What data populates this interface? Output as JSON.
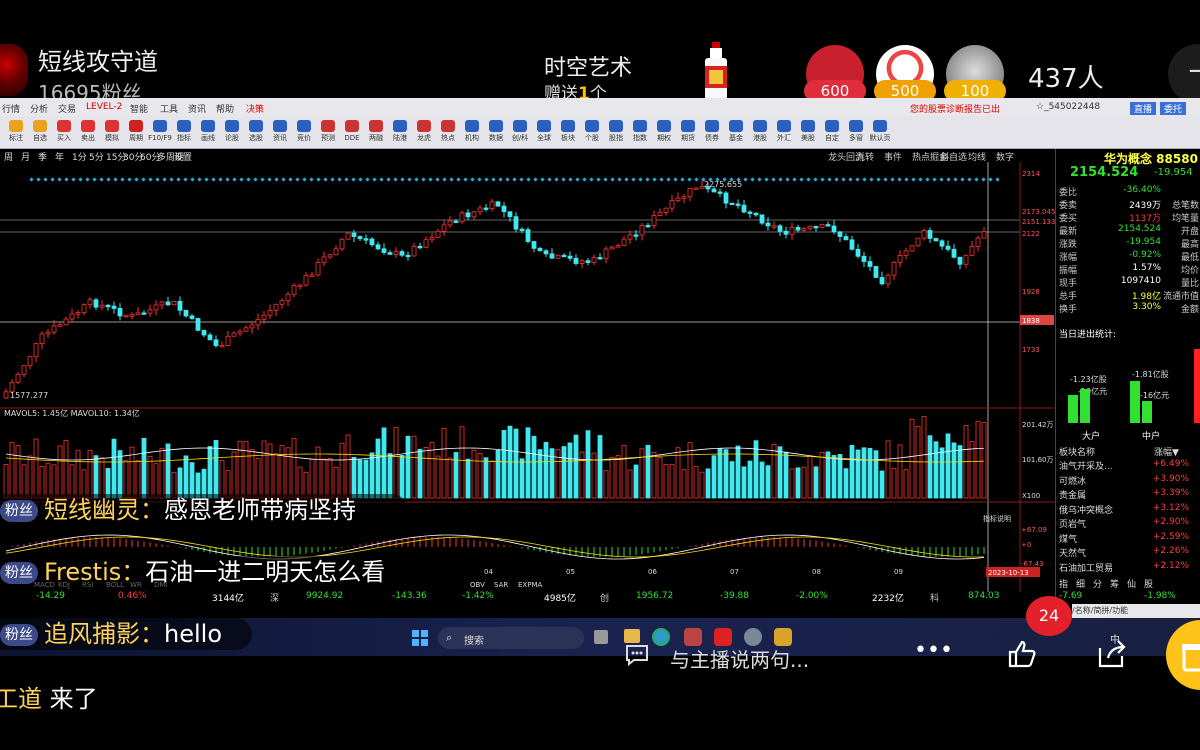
{
  "stream": {
    "streamer_name": "短线攻守道",
    "fans": "16695粉丝",
    "gift_title": "时空艺术",
    "gift_prefix": "赠送",
    "gift_count": "1",
    "gift_suffix": "个",
    "rank_badges": [
      "600",
      "500",
      "100"
    ],
    "viewer_count": "437人",
    "close_symbol": "¬",
    "notification_count": "24",
    "say_placeholder": "与主播说两句...",
    "more_symbol": "•••"
  },
  "chat": [
    {
      "badge": "粉丝",
      "user": "短线幽灵：",
      "message": "感恩老师带病坚持"
    },
    {
      "badge": "粉丝",
      "user": "Frestis：",
      "message": "石油一进二明天怎么看"
    },
    {
      "badge": "粉丝",
      "user": "追风捕影：",
      "message": "hello"
    },
    {
      "badge": "",
      "user": "工道",
      "message": " 来了"
    }
  ],
  "software": {
    "menu": [
      "行情",
      "分析",
      "交易",
      "LEVEL-2",
      "智能",
      "工具",
      "资讯",
      "帮助",
      "决策"
    ],
    "menu_right": "您的股票诊断报告已出",
    "menu_account": "☆_545022448",
    "menu_buttons": [
      "直播",
      "委托"
    ],
    "toolbar": [
      "标注",
      "自选",
      "买入",
      "卖出",
      "模拟",
      "周期",
      "F10/F9",
      "指标",
      "画线",
      "论股",
      "选股",
      "资讯",
      "竞价",
      "预测",
      "DDE",
      "两融",
      "陆港",
      "龙虎",
      "热点",
      "机构",
      "数据",
      "创/科",
      "全球",
      "板块",
      "个股",
      "股指",
      "指数",
      "期权",
      "期货",
      "债券",
      "基金",
      "港股",
      "外汇",
      "美股",
      "自定",
      "多窗",
      "默认页"
    ],
    "periods": [
      "周",
      "月",
      "季",
      "年",
      "1分",
      "5分",
      "15分",
      "30分",
      "60分",
      "多周期",
      "设置"
    ],
    "chart_tabs": [
      "龙头回测",
      "九转",
      "事件",
      "热点掘金",
      "斜自选",
      "均线",
      "数字"
    ],
    "kline": {
      "high_label": "2275.655",
      "low_label": "1577.277",
      "right_axis": [
        "2314",
        "2173.045",
        "2151.133",
        "2122",
        "1928",
        "1838",
        "1733"
      ],
      "volume_label": "MAVOL5: 1.45亿   MAVOL10: 1.34亿",
      "volume_axis": [
        "201.42万",
        "101.60万",
        "X100"
      ],
      "macd_axis": [
        "指标说明",
        "+67.09",
        "+0",
        "-67.43"
      ],
      "months": [
        "04",
        "05",
        "06",
        "07",
        "08",
        "09"
      ],
      "date_tag": "2023-10-13"
    },
    "indicator_tabs": [
      "MACD",
      "KDJ",
      "RSI",
      "BOLL",
      "WR",
      "DMI",
      "OBV",
      "SAR",
      "EXPMA"
    ],
    "index_strip": [
      "-14.29",
      "0.46%",
      "3144亿",
      "深",
      "9924.92",
      "-143.36",
      "-1.42%",
      "4985亿",
      "创",
      "1956.72",
      "-39.88",
      "-2.00%",
      "2232亿",
      "科",
      "874.03"
    ],
    "quote": {
      "title": "华为概念 88580",
      "price": "2154.524",
      "change": "-19.954",
      "rows": [
        {
          "l": "委比",
          "v": "-36.40%",
          "c": "#32e032",
          "r": ""
        },
        {
          "l": "委卖",
          "v": "2439万",
          "c": "#fff",
          "r": "总笔数"
        },
        {
          "l": "委买",
          "v": "1137万",
          "c": "#ff3b3b",
          "r": "均笔量"
        },
        {
          "l": "最新",
          "v": "2154.524",
          "c": "#32e032",
          "r": "开盘"
        },
        {
          "l": "涨跌",
          "v": "-19.954",
          "c": "#32e032",
          "r": "最高"
        },
        {
          "l": "涨幅",
          "v": "-0.92%",
          "c": "#32e032",
          "r": "最低"
        },
        {
          "l": "振幅",
          "v": "1.57%",
          "c": "#fff",
          "r": "均价"
        },
        {
          "l": "现手",
          "v": "1097410",
          "c": "#fff",
          "r": "量比"
        },
        {
          "l": "总手",
          "v": "1.98亿",
          "c": "#ffff40",
          "r": "流通市值"
        },
        {
          "l": "换手",
          "v": "3.30%",
          "c": "#ffff40",
          "r": "金额"
        }
      ],
      "flow_title": "当日进出统计:",
      "flow_labels": [
        "-1.23亿股",
        "-10亿元",
        "-1.81亿股",
        "-16亿元"
      ],
      "flow_cols": [
        "大户",
        "中户"
      ],
      "sector_header": [
        "板块名称",
        "涨幅▼"
      ],
      "sectors": [
        {
          "n": "油气开采及...",
          "p": "+6.49%"
        },
        {
          "n": "可燃冰",
          "p": "+3.90%"
        },
        {
          "n": "贵金属",
          "p": "+3.39%"
        },
        {
          "n": "俄乌冲突概念",
          "p": "+3.12%"
        },
        {
          "n": "页岩气",
          "p": "+2.90%"
        },
        {
          "n": "煤气",
          "p": "+2.59%"
        },
        {
          "n": "天然气",
          "p": "+2.26%"
        },
        {
          "n": "石油加工贸易",
          "p": "+2.12%"
        }
      ],
      "sector_tabs": [
        "指",
        "细",
        "分",
        "筹",
        "仙",
        "股"
      ],
      "bottom": [
        "-7.69",
        "-1.98%"
      ]
    },
    "taskbar": {
      "search": "搜索",
      "tray": "中",
      "keyboard_hint": "/名称/简拼/功能"
    }
  }
}
